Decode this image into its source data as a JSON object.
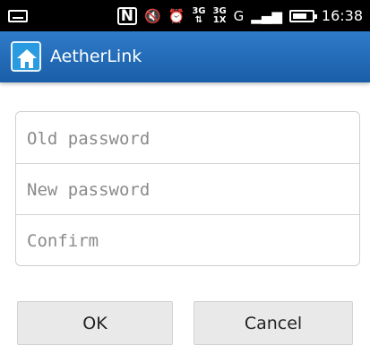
{
  "status_bar": {
    "network_1": "3G",
    "signal_text_top": "3G",
    "signal_text_bottom": "1X",
    "network_2": "G",
    "time": "16:38",
    "icons": [
      "keyboard-icon",
      "nfc-icon",
      "mute-icon",
      "alarm-icon",
      "3g-data-icon",
      "signal-icon",
      "g-icon",
      "signal-bars-icon",
      "battery-icon"
    ]
  },
  "app_bar": {
    "title": "AetherLink",
    "icon": "home-icon",
    "color": "#1f66b3"
  },
  "form": {
    "old_password_placeholder": "Old password",
    "new_password_placeholder": "New password",
    "confirm_placeholder": "Confirm"
  },
  "buttons": {
    "ok_label": "OK",
    "cancel_label": "Cancel"
  }
}
